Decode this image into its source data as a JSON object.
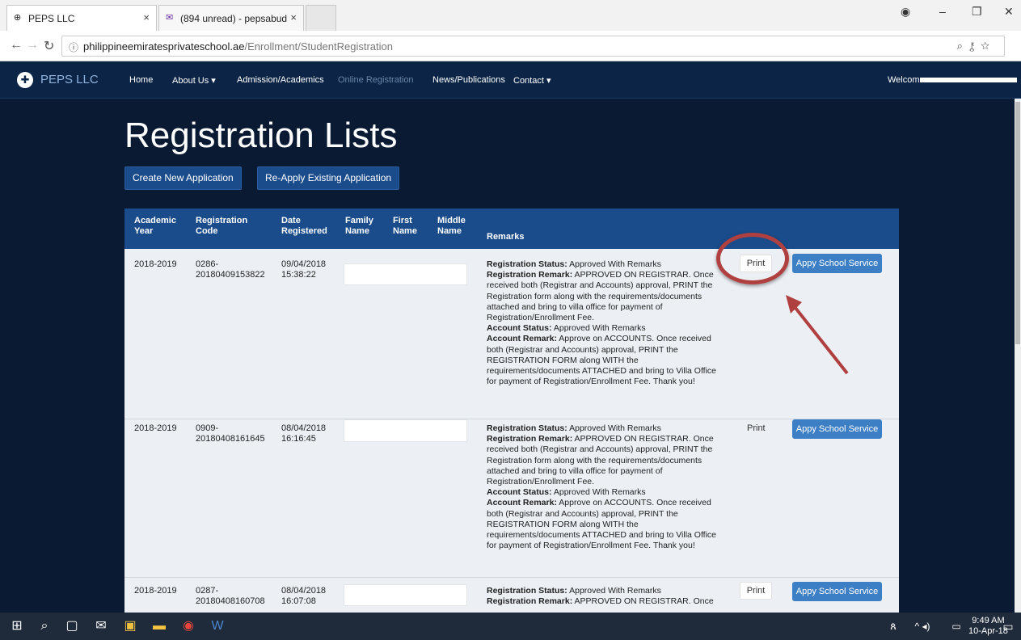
{
  "browser": {
    "tabs": [
      {
        "label": "PEPS LLC",
        "icon": "globe-icon"
      },
      {
        "label": "(894 unread) - pepsabud",
        "icon": "mail-icon"
      }
    ],
    "url_domain": "philippineemiratesprivateschool.ae",
    "url_path": "/Enrollment/StudentRegistration"
  },
  "site": {
    "brand": "PEPS LLC",
    "nav": [
      "Home",
      "About Us",
      "Admission/Academics",
      "Online Registration",
      "News/Publications",
      "Contact"
    ],
    "welcome": "Welcome"
  },
  "page": {
    "title": "Registration Lists",
    "create_btn": "Create New Application",
    "reapply_btn": "Re-Apply Existing Application"
  },
  "table": {
    "headers": {
      "year": [
        "Academic",
        "Year"
      ],
      "code": [
        "Registration",
        "Code"
      ],
      "date": [
        "Date",
        "Registered"
      ],
      "family": [
        "Family",
        "Name"
      ],
      "first": [
        "First",
        "Name"
      ],
      "middle": [
        "Middle",
        "Name"
      ],
      "remarks": "Remarks"
    },
    "rows": [
      {
        "year": "2018-2019",
        "code1": "0286-",
        "code2": "20180409153822",
        "date1": "09/04/2018",
        "date2": "15:38:22"
      },
      {
        "year": "2018-2019",
        "code1": "0909-",
        "code2": "20180408161645",
        "date1": "08/04/2018",
        "date2": "16:16:45"
      },
      {
        "year": "2018-2019",
        "code1": "0287-",
        "code2": "20180408160708",
        "date1": "08/04/2018",
        "date2": "16:07:08"
      }
    ],
    "remark_labels": {
      "reg_status": "Registration Status:",
      "reg_remark": "Registration Remark:",
      "acc_status": "Account Status:",
      "acc_remark": "Account Remark:"
    },
    "remark_values": {
      "reg_status": "Approved With Remarks",
      "reg_remark": "APPROVED ON REGISTRAR. Once received both (Registrar and Accounts) approval, PRINT the Registration form along with the requirements/documents attached and bring to villa office for payment of Registration/Enrollment Fee.",
      "acc_status": "Approved With Remarks",
      "acc_remark": "Approve on ACCOUNTS. Once received both (Registrar and Accounts) approval, PRINT the REGISTRATION FORM along WITH the requirements/documents ATTACHED and bring to Villa Office for payment of Registration/Enrollment Fee. Thank you!",
      "reg_remark_short": "APPROVED ON REGISTRAR. Once"
    },
    "print_label": "Print",
    "apply_label": "Appy School Service"
  },
  "taskbar": {
    "time": "9:49 AM",
    "date": "10-Apr-18"
  }
}
